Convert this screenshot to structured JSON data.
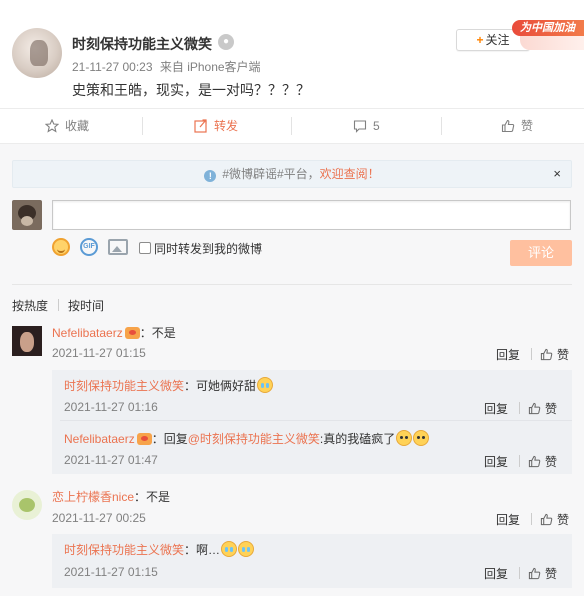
{
  "post": {
    "author": "时刻保持功能主义微笑",
    "time": "21-11-27 00:23",
    "source": "来自 iPhone客户端",
    "text": "史策和王皓，现实，是一对吗？？？？",
    "follow_label": "关注",
    "badge_text": "为中国加油"
  },
  "actions": {
    "favorite": "收藏",
    "repost": "转发",
    "comment_count": "5",
    "like": "赞"
  },
  "comment_box": {
    "notice_prefix": "#微博辟谣#平台，",
    "notice_link": "欢迎查阅！",
    "notice_close": "×",
    "input_value": "",
    "repost_checkbox_label": "同时转发到我的微博",
    "submit_label": "评论",
    "sort_hot": "按热度",
    "sort_time": "按时间"
  },
  "labels": {
    "reply": "回复",
    "like": "赞"
  },
  "comments": [
    {
      "user": "Nefelibataerz",
      "text": "：不是",
      "time": "2021-11-27 01:15",
      "replies": [
        {
          "user": "时刻保持功能主义微笑",
          "text": "：可她俩好甜",
          "time": "2021-11-27 01:16"
        },
        {
          "user": "Nefelibataerz",
          "text_prefix": "：回复",
          "mention": "@时刻保持功能主义微笑",
          "text": ":真的我磕疯了",
          "time": "2021-11-27 01:47"
        }
      ]
    },
    {
      "user": "恋上柠檬香nice",
      "text": "：不是",
      "time": "2021-11-27 00:25",
      "replies": [
        {
          "user": "时刻保持功能主义微笑",
          "text": "：啊…",
          "time": "2021-11-27 01:15"
        }
      ]
    }
  ]
}
